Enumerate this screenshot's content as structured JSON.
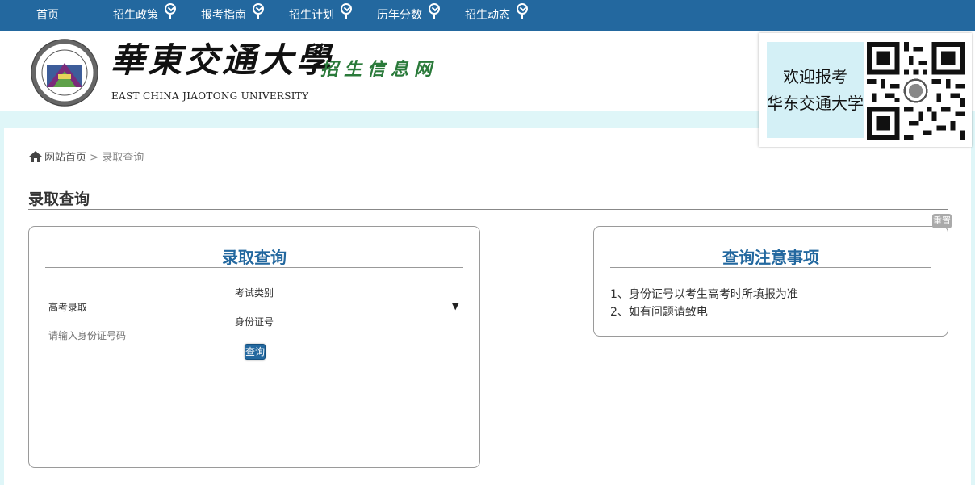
{
  "nav": {
    "home": "首页",
    "items": [
      "招生政策",
      "报考指南",
      "招生计划",
      "历年分数",
      "招生动态"
    ]
  },
  "header": {
    "brand_cn": "華東交通大學",
    "brand_en": "EAST CHINA JIAOTONG UNIVERSITY",
    "brand_sub": "招生信息网"
  },
  "qr": {
    "line1": "欢迎报考",
    "line2": "华东交通大学"
  },
  "breadcrumb": {
    "home": "网站首页",
    "separator": " > ",
    "current": "录取查询"
  },
  "page_title": "录取查询",
  "query_panel": {
    "title": "录取查询",
    "exam_type_label": "考试类别",
    "exam_type_value": "高考录取",
    "id_label": "身份证号",
    "id_placeholder": "请输入身份证号码",
    "query_button": "查询",
    "reset_button": "重置"
  },
  "notice_panel": {
    "title": "查询注意事项",
    "items": [
      "1、身份证号以考生高考时所填报为准",
      "2、如有问题请致电"
    ]
  },
  "colors": {
    "nav_bg": "#23689f",
    "accent": "#23689f",
    "page_bg": "#dff6f8"
  }
}
